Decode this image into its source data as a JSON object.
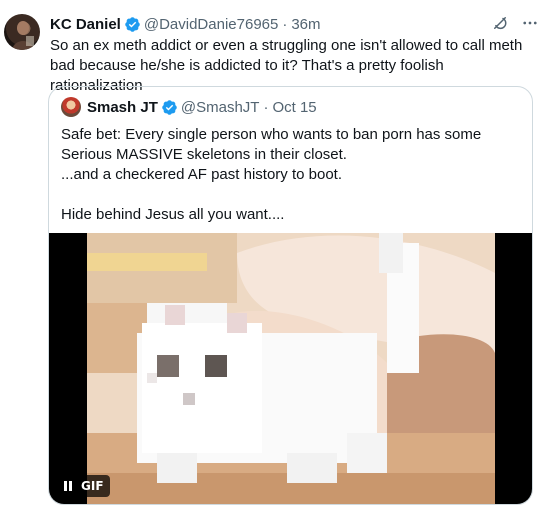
{
  "colors": {
    "accent": "#1d9bf0",
    "secondary_text": "#536471",
    "border": "#cfd9de"
  },
  "tweet": {
    "author_name": "KC Daniel",
    "author_handle": "@DavidDanie76965",
    "separator": "·",
    "time": "36m",
    "text": "So an ex meth addict or even a struggling one isn't allowed to call meth bad because he/she is addicted to it? That's a pretty foolish rationalization",
    "icons": [
      "verified-badge-icon",
      "grok-icon",
      "more-icon"
    ]
  },
  "quoted": {
    "author_name": "Smash JT",
    "author_handle": "@SmashJT",
    "separator": "·",
    "date": "Oct 15",
    "lines": [
      "Safe bet: Every single person who wants to ban porn has some Serious MASSIVE skeletons in their closet.",
      "...and a checkered AF past history to boot.",
      "",
      "Hide behind Jesus all you want...."
    ],
    "media": {
      "type": "gif",
      "badge": "GIF",
      "control_icon": "pause-icon"
    }
  }
}
